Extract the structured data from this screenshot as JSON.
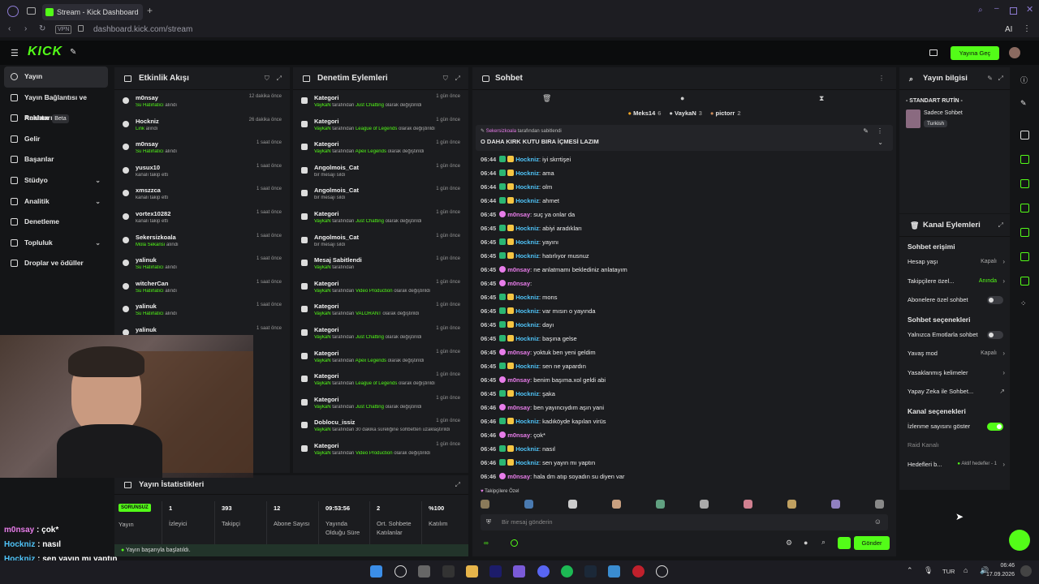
{
  "browser": {
    "tab_title": "Stream - Kick Dashboard",
    "url": "dashboard.kick.com/stream",
    "vpn": "VPN",
    "ai_label": "AI"
  },
  "app": {
    "logo": "KICK",
    "go_live": "Yayına Geç"
  },
  "nav": [
    {
      "label": "Yayın",
      "active": true
    },
    {
      "label": "Yayın Bağlantısı ve Anahtarı"
    },
    {
      "label": "Reklam",
      "badge": "Beta"
    },
    {
      "label": "Gelir"
    },
    {
      "label": "Başarılar"
    },
    {
      "label": "Stüdyo",
      "chevron": true
    },
    {
      "label": "Analitik",
      "chevron": true
    },
    {
      "label": "Denetleme"
    },
    {
      "label": "Topluluk",
      "chevron": true
    },
    {
      "label": "Droplar ve ödüller"
    }
  ],
  "activity": {
    "title": "Etkinlik Akışı",
    "items": [
      {
        "name": "m0nsay",
        "hl": "Su Hatırlatıcı",
        "rest": " alındı",
        "time": "12 dakika önce"
      },
      {
        "name": "Hockniz",
        "hl": "Link",
        "rest": " alındı",
        "time": "26 dakika önce"
      },
      {
        "name": "m0nsay",
        "hl": "Su Hatırlatıcı",
        "rest": " alındı",
        "time": "1 saat önce"
      },
      {
        "name": "yusux10",
        "hl": "",
        "rest": "kanalı takip etti",
        "time": "1 saat önce"
      },
      {
        "name": "xmszzca",
        "hl": "",
        "rest": "kanalı takip etti",
        "time": "1 saat önce"
      },
      {
        "name": "vortex10282",
        "hl": "",
        "rest": "kanalı takip etti",
        "time": "1 saat önce"
      },
      {
        "name": "Sekersizkoala",
        "hl": "Mola Sekansı",
        "rest": " alındı",
        "time": "1 saat önce"
      },
      {
        "name": "yalinuk",
        "hl": "Su Hatırlatıcı",
        "rest": " alındı",
        "time": "1 saat önce"
      },
      {
        "name": "witcherCan",
        "hl": "Su Hatırlatıcı",
        "rest": " alındı",
        "time": "1 saat önce"
      },
      {
        "name": "yalinuk",
        "hl": "Su Hatırlatıcı",
        "rest": " alındı",
        "time": "1 saat önce"
      },
      {
        "name": "yalinuk",
        "hl": "",
        "rest": "",
        "time": "1 saat önce"
      }
    ]
  },
  "moderation": {
    "title": "Denetim Eylemleri",
    "items": [
      {
        "name": "Kategori",
        "user": "VaykaN",
        "mid": " tarafından ",
        "hl": "Just Chatting",
        "rest": " olarak değiştirildi",
        "time": "1 gün önce"
      },
      {
        "name": "Kategori",
        "user": "VaykaN",
        "mid": " tarafından ",
        "hl": "League of Legends",
        "rest": " olarak değiştirildi",
        "time": "1 gün önce"
      },
      {
        "name": "Kategori",
        "user": "VaykaN",
        "mid": " tarafından ",
        "hl": "Apex Legends",
        "rest": " olarak değiştirildi",
        "time": "1 gün önce"
      },
      {
        "name": "Angolmois_Cat",
        "user": "",
        "mid": "bir mesajı sildi",
        "hl": "",
        "rest": "",
        "time": "1 gün önce"
      },
      {
        "name": "Angolmois_Cat",
        "user": "",
        "mid": "bir mesajı sildi",
        "hl": "",
        "rest": "",
        "time": "1 gün önce"
      },
      {
        "name": "Kategori",
        "user": "VaykaN",
        "mid": " tarafından ",
        "hl": "Just Chatting",
        "rest": " olarak değiştirildi",
        "time": "1 gün önce"
      },
      {
        "name": "Angolmois_Cat",
        "user": "",
        "mid": "bir mesajı sildi",
        "hl": "",
        "rest": "",
        "time": "1 gün önce"
      },
      {
        "name": "Mesaj Sabitlendi",
        "user": "VaykaN",
        "mid": " tarafından",
        "hl": "",
        "rest": "",
        "time": "1 gün önce"
      },
      {
        "name": "Kategori",
        "user": "VaykaN",
        "mid": " tarafından ",
        "hl": "Video Production",
        "rest": " olarak değiştirildi",
        "time": "1 gün önce"
      },
      {
        "name": "Kategori",
        "user": "VaykaN",
        "mid": " tarafından ",
        "hl": "VALORANT",
        "rest": " olarak değiştirildi",
        "time": "1 gün önce"
      },
      {
        "name": "Kategori",
        "user": "VaykaN",
        "mid": " tarafından ",
        "hl": "Just Chatting",
        "rest": " olarak değiştirildi",
        "time": "1 gün önce"
      },
      {
        "name": "Kategori",
        "user": "VaykaN",
        "mid": " tarafından ",
        "hl": "Apex Legends",
        "rest": " olarak değiştirildi",
        "time": "1 gün önce"
      },
      {
        "name": "Kategori",
        "user": "VaykaN",
        "mid": " tarafından ",
        "hl": "League of Legends",
        "rest": " olarak değiştirildi",
        "time": "1 gün önce"
      },
      {
        "name": "Kategori",
        "user": "VaykaN",
        "mid": " tarafından ",
        "hl": "Just Chatting",
        "rest": " olarak değiştirildi",
        "time": "1 gün önce"
      },
      {
        "name": "Doblocu_issiz",
        "user": "VaykaN",
        "mid": " tarafından 30 dakika süreliğine sohbetten uzaklaştırıldı",
        "hl": "",
        "rest": "",
        "time": "1 gün önce"
      },
      {
        "name": "Kategori",
        "user": "VaykaN",
        "mid": " tarafından ",
        "hl": "Video Production",
        "rest": " olarak değiştirildi",
        "time": "1 gün önce"
      }
    ]
  },
  "chat": {
    "title": "Sohbet",
    "leaders": [
      {
        "name": "Meks14",
        "count": "6"
      },
      {
        "name": "VaykaN",
        "count": "3"
      },
      {
        "name": "pictorr",
        "count": "2"
      }
    ],
    "pinned_by": "Sekersizkoala",
    "pinned_by_rest": " tarafından sabitlendi",
    "pinned_text": "O DAHA KIRK KUTU BIRA İÇMESİ LAZIM",
    "messages": [
      {
        "time": "06:44",
        "user": "Hockniz",
        "color": "#4fc3f7",
        "text": ": iyi skrrtişei"
      },
      {
        "time": "06:44",
        "user": "Hockniz",
        "color": "#4fc3f7",
        "text": ": ama"
      },
      {
        "time": "06:44",
        "user": "Hockniz",
        "color": "#4fc3f7",
        "text": ": olm"
      },
      {
        "time": "06:44",
        "user": "Hockniz",
        "color": "#4fc3f7",
        "text": ": ahmet"
      },
      {
        "time": "06:45",
        "user": "m0nsay",
        "color": "#e87dea",
        "text": ": suç ya onlar da"
      },
      {
        "time": "06:45",
        "user": "Hockniz",
        "color": "#4fc3f7",
        "text": ": abiyi aradıkları"
      },
      {
        "time": "06:45",
        "user": "Hockniz",
        "color": "#4fc3f7",
        "text": ": yayını"
      },
      {
        "time": "06:45",
        "user": "Hockniz",
        "color": "#4fc3f7",
        "text": ": hatırlıyor musnuz"
      },
      {
        "time": "06:45",
        "user": "m0nsay",
        "color": "#e87dea",
        "text": ": ne anlatmamı beklediniz anlatayım"
      },
      {
        "time": "06:45",
        "user": "m0nsay",
        "color": "#e87dea",
        "text": ":"
      },
      {
        "time": "06:45",
        "user": "Hockniz",
        "color": "#4fc3f7",
        "text": ": mons"
      },
      {
        "time": "06:45",
        "user": "Hockniz",
        "color": "#4fc3f7",
        "text": ": var mısın o yayında"
      },
      {
        "time": "06:45",
        "user": "Hockniz",
        "color": "#4fc3f7",
        "text": ": dayı"
      },
      {
        "time": "06:45",
        "user": "Hockniz",
        "color": "#4fc3f7",
        "text": ": başına gelse"
      },
      {
        "time": "06:45",
        "user": "m0nsay",
        "color": "#e87dea",
        "text": ": yoktuk ben yeni geldim"
      },
      {
        "time": "06:45",
        "user": "Hockniz",
        "color": "#4fc3f7",
        "text": ": sen ne yapardın"
      },
      {
        "time": "06:45",
        "user": "m0nsay",
        "color": "#e87dea",
        "text": ": benim başıma.xol geldi abi"
      },
      {
        "time": "06:45",
        "user": "Hockniz",
        "color": "#4fc3f7",
        "text": ": şaka"
      },
      {
        "time": "06:46",
        "user": "m0nsay",
        "color": "#e87dea",
        "text": ": ben yayıncıydım aşın yani"
      },
      {
        "time": "06:46",
        "user": "Hockniz",
        "color": "#4fc3f7",
        "text": ": kadıköyde kapılan virüs"
      },
      {
        "time": "06:46",
        "user": "m0nsay",
        "color": "#e87dea",
        "text": ": çok*"
      },
      {
        "time": "06:46",
        "user": "Hockniz",
        "color": "#4fc3f7",
        "text": ": nasıl"
      },
      {
        "time": "06:46",
        "user": "Hockniz",
        "color": "#4fc3f7",
        "text": ": sen yayın mı yaptın"
      },
      {
        "time": "06:46",
        "user": "m0nsay",
        "color": "#e87dea",
        "text": ": hala dm atıp soyadın su diyen var"
      }
    ],
    "followers_only": "Takipçilere Özel",
    "input_placeholder": "Bir mesaj gönderin",
    "send": "Gönder"
  },
  "stream_info": {
    "title": "Yayın bilgisi",
    "stream_title": "- STANDART RUTİN -",
    "category": "Sadece Sohbet",
    "language": "Turkish"
  },
  "channel_actions": {
    "title": "Kanal Eylemleri",
    "chat_access": "Sohbet erişimi",
    "account_age": "Hesap yaşı",
    "account_age_val": "Kapalı",
    "followers_only": "Takipçilere özel...",
    "followers_only_val": "Anında",
    "subs_only": "Abonelere özel sohbet",
    "chat_options": "Sohbet seçenekleri",
    "emote_only": "Yalnızca Emotlarla sohbet",
    "slow_mode": "Yavaş mod",
    "slow_mode_val": "Kapalı",
    "banned_words": "Yasaklanmış kelimeler",
    "ai_chat": "Yapay Zeka ile Sohbet...",
    "channel_options": "Kanal seçenekleri",
    "show_viewers": "İzlenme sayısını göster",
    "raid": "Raid Kanalı",
    "goals": "Hedefleri b...",
    "goals_val": "Aktif hedefler - 1"
  },
  "stats": {
    "title": "Yayın İstatistikleri",
    "status_badge": "SORUNSUZ",
    "status_label": "Yayın",
    "items": [
      {
        "value": "1",
        "label": "İzleyici"
      },
      {
        "value": "393",
        "label": "Takipçi"
      },
      {
        "value": "12",
        "label": "Abone Sayısı"
      },
      {
        "value": "09:53:56",
        "label": "Yayında Olduğu Süre"
      },
      {
        "value": "2",
        "label": "Ort. Sohbete Katılanlar"
      },
      {
        "value": "%100",
        "label": "Katılım"
      }
    ],
    "toast": "Yayın başarıyla başlatıldı."
  },
  "overlay_chat": [
    {
      "user": "m0nsay",
      "color": "#e87dea",
      "text": " : çok*"
    },
    {
      "user": "Hockniz",
      "color": "#4fc3f7",
      "text": " : nasıl"
    },
    {
      "user": "Hockniz",
      "color": "#4fc3f7",
      "text": " : sen yayın mı yaptın"
    },
    {
      "user": "m0nsay",
      "color": "#e87dea",
      "text": " : hala dm atıp soyadın su diyen var"
    }
  ],
  "taskbar": {
    "lang": "TUR",
    "time": "06:46",
    "date": "17.09.2026"
  }
}
